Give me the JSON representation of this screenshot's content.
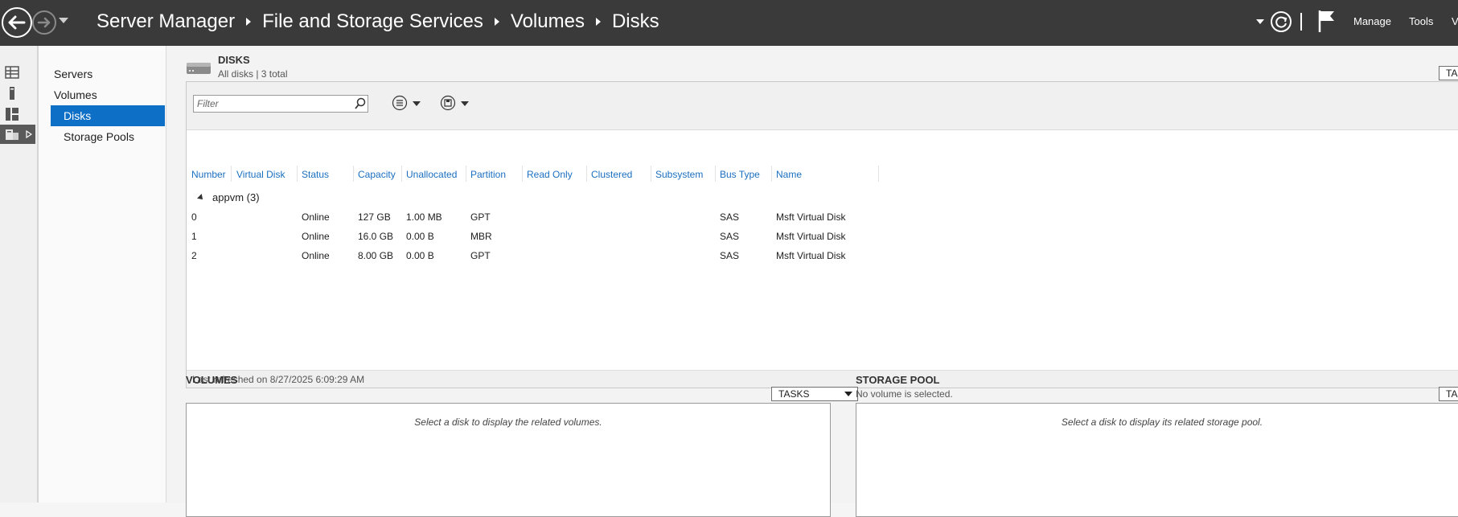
{
  "titlebar": {
    "breadcrumb": [
      "Server Manager",
      "File and Storage Services",
      "Volumes",
      "Disks"
    ],
    "menus": [
      "Manage",
      "Tools",
      "V"
    ]
  },
  "nav": {
    "items": [
      "Servers",
      "Volumes",
      "Disks",
      "Storage Pools"
    ],
    "selected": "Disks"
  },
  "disks": {
    "title": "DISKS",
    "subtitle": "All disks | 3 total",
    "tasks_label": "TA",
    "filter_placeholder": "Filter",
    "columns": [
      "Number",
      "Virtual Disk",
      "Status",
      "Capacity",
      "Unallocated",
      "Partition",
      "Read Only",
      "Clustered",
      "Subsystem",
      "Bus Type",
      "Name"
    ],
    "group": "appvm (3)",
    "rows": [
      {
        "number": "0",
        "virtual_disk": "",
        "status": "Online",
        "capacity": "127 GB",
        "unallocated": "1.00 MB",
        "partition": "GPT",
        "read_only": "",
        "clustered": "",
        "subsystem": "",
        "bus_type": "SAS",
        "name": "Msft Virtual Disk"
      },
      {
        "number": "1",
        "virtual_disk": "",
        "status": "Online",
        "capacity": "16.0 GB",
        "unallocated": "0.00 B",
        "partition": "MBR",
        "read_only": "",
        "clustered": "",
        "subsystem": "",
        "bus_type": "SAS",
        "name": "Msft Virtual Disk"
      },
      {
        "number": "2",
        "virtual_disk": "",
        "status": "Online",
        "capacity": "8.00 GB",
        "unallocated": "0.00 B",
        "partition": "GPT",
        "read_only": "",
        "clustered": "",
        "subsystem": "",
        "bus_type": "SAS",
        "name": "Msft Virtual Disk"
      }
    ],
    "last_refreshed": "Last refreshed on 8/27/2025 6:09:29 AM"
  },
  "volumes": {
    "title": "VOLUMES",
    "tasks_label": "TASKS",
    "message": "Select a disk to display the related volumes."
  },
  "storage_pool": {
    "title": "STORAGE POOL",
    "subtitle": "No volume is selected.",
    "tasks_label": "TA",
    "message": "Select a disk to display its related storage pool."
  },
  "colors": {
    "titlebar_bg": "#3a3a3a",
    "selection": "#0e6fc7",
    "column_header": "#1a6fc0"
  },
  "icons": [
    "back-arrow-icon",
    "forward-arrow-icon",
    "refresh-icon",
    "notifications-flag-icon",
    "dashboard-icon",
    "local-server-icon",
    "all-servers-icon",
    "file-storage-icon",
    "disk-drive-icon",
    "search-icon",
    "list-options-icon",
    "save-query-icon"
  ]
}
